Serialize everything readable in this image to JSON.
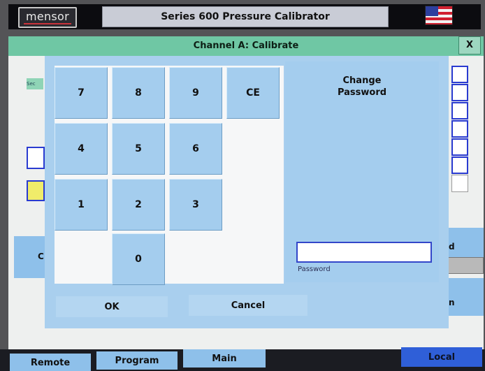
{
  "header": {
    "logo_text": "mensor",
    "title": "Series 600 Pressure Calibrator"
  },
  "channel": {
    "title": "Channel A: Calibrate",
    "close_label": "X"
  },
  "background": {
    "tag_text": "Sec",
    "left_button_fragment": "C",
    "right_button_fragment_1": "d",
    "right_button_fragment_2": "n"
  },
  "keypad": {
    "keys": [
      "7",
      "8",
      "9",
      "CE",
      "4",
      "5",
      "6",
      "1",
      "2",
      "3",
      "0"
    ]
  },
  "side_panel": {
    "title": "Change Password",
    "password_value": "",
    "password_label": "Password"
  },
  "dialog_buttons": {
    "ok": "OK",
    "cancel": "Cancel"
  },
  "bottom_tabs": {
    "remote": "Remote",
    "program": "Program",
    "main": "Main",
    "local": "Local"
  },
  "colors": {
    "channel_bar": "#6fc7a4",
    "dialog": "#a9cfee",
    "accent_blue": "#3346c9",
    "local_tab": "#2f5fd8"
  }
}
